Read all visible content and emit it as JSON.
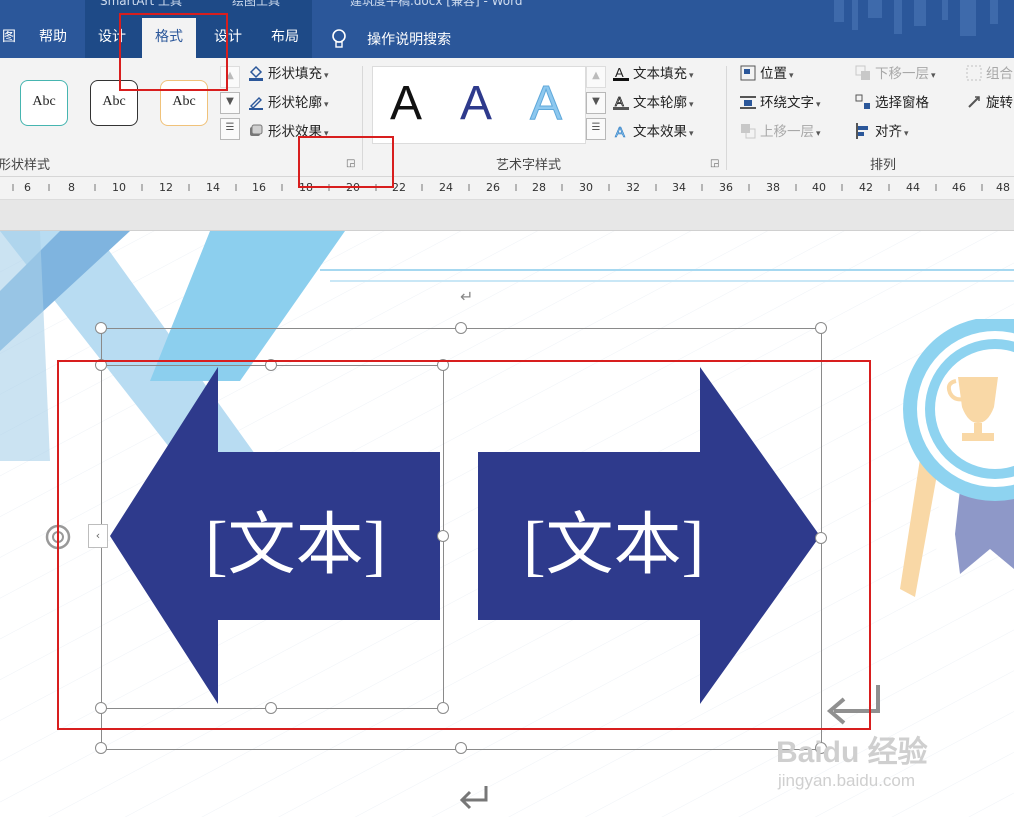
{
  "title_fragments": [
    "SmartArt 工具",
    "绘图工具",
    "建筑度平稿.docx [兼容] - Word"
  ],
  "tabs": [
    {
      "label": "图",
      "active": false
    },
    {
      "label": "帮助",
      "active": false
    },
    {
      "label": "设计",
      "active": false
    },
    {
      "label": "格式",
      "active": true
    },
    {
      "label": "设计",
      "active": false
    },
    {
      "label": "布局",
      "active": false
    }
  ],
  "search": {
    "label": "操作说明搜索",
    "icon": "lightbulb-icon"
  },
  "shape_styles": {
    "group_label": "形状样式",
    "gallery": [
      {
        "text": "Abc",
        "border_color": "#46b5b0"
      },
      {
        "text": "Abc",
        "border_color": "#333333"
      },
      {
        "text": "Abc",
        "border_color": "#f0c27a"
      }
    ],
    "commands": {
      "fill": "形状填充",
      "outline": "形状轮廓",
      "effect": "形状效果"
    }
  },
  "wordart_styles": {
    "group_label": "艺术字样式",
    "gallery": [
      {
        "text": "A",
        "color": "#111111"
      },
      {
        "text": "A",
        "color": "#2e3a8c"
      },
      {
        "text": "A",
        "color": "#8dc8ef"
      }
    ],
    "commands": {
      "fill": "文本填充",
      "outline": "文本轮廓",
      "effect": "文本效果"
    }
  },
  "arrange": {
    "group_label": "排列",
    "position": "位置",
    "wrap": "环绕文字",
    "bring_forward": "上移一层",
    "send_backward": "下移一层",
    "selection_pane": "选择窗格",
    "align": "对齐",
    "group": "组合",
    "rotate": "旋转"
  },
  "ruler_numbers": [
    "6",
    "8",
    "10",
    "12",
    "14",
    "16",
    "18",
    "20",
    "22",
    "24",
    "26",
    "28",
    "30",
    "32",
    "34",
    "36",
    "38",
    "40",
    "42",
    "44",
    "46",
    "48"
  ],
  "smartart": {
    "left_text": "[文本]",
    "right_text": "[文本]",
    "arrow_color": "#2e3a8c"
  },
  "decor": {
    "light_blue": "#8ccfee",
    "mid_blue": "#7fb4df",
    "medal_blue": "#8ed3f0",
    "trophy_color": "#f9d8a6",
    "ribbon_color": "#8e98c8"
  },
  "annotation_color": "#d81e1e",
  "paragraph_mark": "↵",
  "watermark": {
    "line1": "Baidu 经验",
    "line2": "jingyan.baidu.com"
  }
}
